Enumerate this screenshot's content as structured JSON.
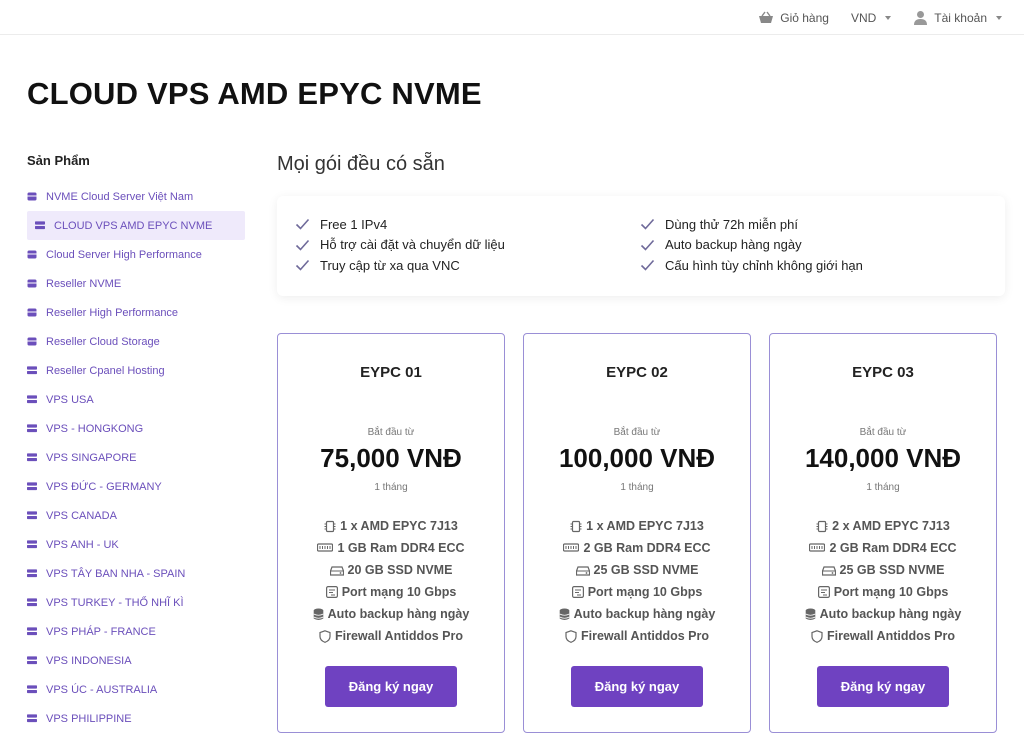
{
  "topbar": {
    "cart_label": "Giỏ hàng",
    "currency": "VND",
    "account_label": "Tài khoản"
  },
  "page_title": "CLOUD VPS AMD EPYC NVME",
  "sidebar": {
    "title": "Sản Phẩm",
    "items": [
      {
        "label": "NVME Cloud Server Việt Nam",
        "icon": "box-icon"
      },
      {
        "label": "CLOUD VPS AMD EPYC NVME",
        "icon": "server-icon",
        "active": true
      },
      {
        "label": "Cloud Server High Performance",
        "icon": "box-icon"
      },
      {
        "label": "Reseller NVME",
        "icon": "box-icon"
      },
      {
        "label": "Reseller High Performance",
        "icon": "box-icon"
      },
      {
        "label": "Reseller Cloud Storage",
        "icon": "box-icon"
      },
      {
        "label": "Reseller Cpanel Hosting",
        "icon": "server-icon"
      },
      {
        "label": "VPS USA",
        "icon": "server-icon"
      },
      {
        "label": "VPS - HONGKONG",
        "icon": "server-icon"
      },
      {
        "label": "VPS SINGAPORE",
        "icon": "server-icon"
      },
      {
        "label": "VPS ĐỨC - GERMANY",
        "icon": "server-icon"
      },
      {
        "label": "VPS CANADA",
        "icon": "server-icon"
      },
      {
        "label": "VPS ANH - UK",
        "icon": "server-icon"
      },
      {
        "label": "VPS TÂY BAN NHA - SPAIN",
        "icon": "server-icon"
      },
      {
        "label": "VPS TURKEY - THỔ NHĨ KÌ",
        "icon": "server-icon"
      },
      {
        "label": "VPS PHÁP - FRANCE",
        "icon": "server-icon"
      },
      {
        "label": "VPS INDONESIA",
        "icon": "server-icon"
      },
      {
        "label": "VPS ÚC - AUSTRALIA",
        "icon": "server-icon"
      },
      {
        "label": "VPS PHILIPPINE",
        "icon": "server-icon"
      }
    ]
  },
  "main": {
    "subtitle": "Mọi gói đều có sẵn",
    "features_left": [
      "Free 1 IPv4",
      "Hỗ trợ cài đặt và chuyển dữ liệu",
      "Truy cập từ xa qua VNC"
    ],
    "features_right": [
      "Dùng thử 72h miễn phí",
      "Auto backup hàng ngày",
      "Cấu hình tùy chỉnh không giới hạn"
    ]
  },
  "plans": [
    {
      "name": "EYPC 01",
      "from_label": "Bắt đầu từ",
      "price": "75,000 VNĐ",
      "period": "1 tháng",
      "specs": [
        "1 x AMD EPYC 7J13",
        "1 GB Ram DDR4 ECC",
        "20 GB SSD NVME",
        "Port mạng 10 Gbps",
        "Auto backup hàng ngày",
        "Firewall Antiddos Pro"
      ],
      "button": "Đăng ký ngay"
    },
    {
      "name": "EYPC 02",
      "from_label": "Bắt đầu từ",
      "price": "100,000 VNĐ",
      "period": "1 tháng",
      "specs": [
        "1 x AMD EPYC 7J13",
        "2 GB Ram DDR4 ECC",
        "25 GB SSD NVME",
        "Port mạng 10 Gbps",
        "Auto backup hàng ngày",
        "Firewall Antiddos Pro"
      ],
      "button": "Đăng ký ngay"
    },
    {
      "name": "EYPC 03",
      "from_label": "Bắt đầu từ",
      "price": "140,000 VNĐ",
      "period": "1 tháng",
      "specs": [
        "2 x AMD EPYC 7J13",
        "2 GB Ram DDR4 ECC",
        "25 GB SSD NVME",
        "Port mạng 10 Gbps",
        "Auto backup hàng ngày",
        "Firewall Antiddos Pro"
      ],
      "button": "Đăng ký ngay"
    }
  ],
  "spec_icons": [
    "cpu-icon",
    "ram-icon",
    "disk-icon",
    "network-icon",
    "database-icon",
    "shield-icon"
  ],
  "colors": {
    "accent": "#6f42c1",
    "sidebar_link": "#6b4fbb",
    "active_bg": "#efeafb",
    "card_border": "#9a8fd6"
  }
}
